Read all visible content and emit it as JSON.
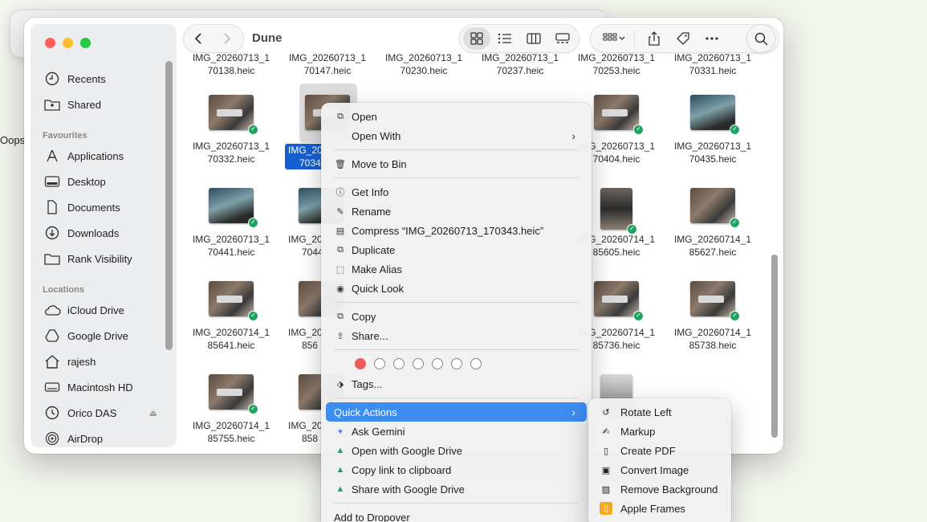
{
  "background": {
    "left_text": "Oops"
  },
  "window": {
    "title": "Dune"
  },
  "sidebar": {
    "top_items": [
      {
        "label": "Recents",
        "icon": "clock-icon"
      },
      {
        "label": "Shared",
        "icon": "shared-folder-icon"
      }
    ],
    "favourites_heading": "Favourites",
    "favourites": [
      {
        "label": "Applications",
        "icon": "applications-icon"
      },
      {
        "label": "Desktop",
        "icon": "desktop-icon"
      },
      {
        "label": "Documents",
        "icon": "document-icon"
      },
      {
        "label": "Downloads",
        "icon": "download-icon"
      },
      {
        "label": "Rank Visibility",
        "icon": "folder-icon"
      }
    ],
    "locations_heading": "Locations",
    "locations": [
      {
        "label": "iCloud Drive",
        "icon": "cloud-icon"
      },
      {
        "label": "Google Drive",
        "icon": "google-drive-icon"
      },
      {
        "label": "rajesh",
        "icon": "home-icon"
      },
      {
        "label": "Macintosh HD",
        "icon": "disk-icon"
      },
      {
        "label": "Orico DAS",
        "icon": "external-drive-icon"
      },
      {
        "label": "AirDrop",
        "icon": "airdrop-icon"
      }
    ]
  },
  "files": {
    "row0": [
      {
        "l1": "IMG_20260713_1",
        "l2": "70138.heic"
      },
      {
        "l1": "IMG_20260713_1",
        "l2": "70147.heic"
      },
      {
        "l1": "IMG_20260713_1",
        "l2": "70230.heic"
      },
      {
        "l1": "IMG_20260713_1",
        "l2": "70237.heic"
      },
      {
        "l1": "IMG_20260713_1",
        "l2": "70253.heic"
      },
      {
        "l1": "IMG_20260713_1",
        "l2": "70331.heic"
      }
    ],
    "row1": [
      {
        "l1": "IMG_20260713_1",
        "l2": "70332.heic"
      },
      {
        "l1": "IMG_20260713_1",
        "l2": "70404.heic"
      },
      {
        "l1": "IMG_20260713_1",
        "l2": "70435.heic"
      }
    ],
    "row2": [
      {
        "l1": "IMG_20260713_1",
        "l2": "70441.heic"
      },
      {
        "l1": "IMG_20260714_1",
        "l2": "85605.heic"
      },
      {
        "l1": "IMG_20260714_1",
        "l2": "85627.heic"
      }
    ],
    "row3": [
      {
        "l1": "IMG_20260714_1",
        "l2": "85641.heic"
      },
      {
        "l1": "IMG_20260714_1",
        "l2": "85736.heic"
      },
      {
        "l1": "IMG_20260714_1",
        "l2": "85738.heic"
      }
    ],
    "row4": [
      {
        "l1": "IMG_20260714_1",
        "l2": "85755.heic"
      }
    ],
    "col2_partial": [
      {
        "l1": "IMG_20",
        "l2": "7044"
      },
      {
        "l1": "IMG_20",
        "l2": "856"
      },
      {
        "l1": "IMG_20",
        "l2": "858"
      }
    ],
    "selected": {
      "l1": "IMG_20",
      "l2": "7034"
    }
  },
  "context_menu": {
    "open": "Open",
    "open_with": "Open With",
    "move_to_bin": "Move to Bin",
    "get_info": "Get Info",
    "rename": "Rename",
    "compress": "Compress “IMG_20260713_170343.heic”",
    "duplicate": "Duplicate",
    "make_alias": "Make Alias",
    "quick_look": "Quick Look",
    "copy": "Copy",
    "share": "Share...",
    "tags": "Tags...",
    "quick_actions": "Quick Actions",
    "ask_gemini": "Ask Gemini",
    "open_google_drive": "Open with Google Drive",
    "copy_link": "Copy link to clipboard",
    "share_google_drive": "Share with Google Drive",
    "add_dropover": "Add to Dropover",
    "tag_colors": [
      "#ee5b5b",
      "none",
      "none",
      "none",
      "none",
      "none",
      "none"
    ]
  },
  "quick_actions_menu": {
    "rotate_left": "Rotate Left",
    "markup": "Markup",
    "create_pdf": "Create PDF",
    "convert_image": "Convert Image",
    "remove_background": "Remove Background",
    "apple_frames": "Apple Frames"
  }
}
